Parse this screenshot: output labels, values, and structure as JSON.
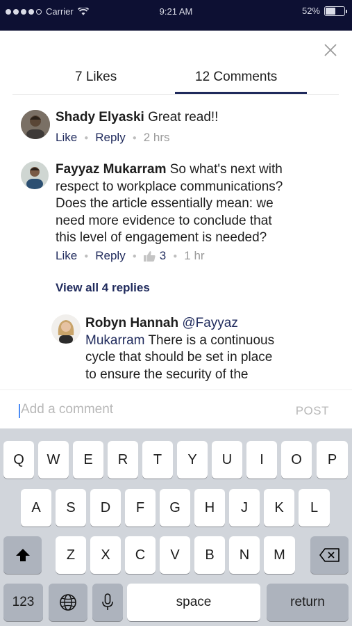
{
  "status_bar": {
    "carrier": "Carrier",
    "time": "9:21 AM",
    "battery": "52%",
    "battery_level": 0.52
  },
  "tabs": {
    "likes": "7 Likes",
    "comments": "12 Comments",
    "active": "comments"
  },
  "comments": [
    {
      "author": "Shady Elyaski",
      "text": " Great read!!",
      "like": "Like",
      "reply": "Reply",
      "time": "2 hrs"
    },
    {
      "author": "Fayyaz Mukarram",
      "text_lines": [
        " So what's next with",
        "respect to workplace communications?",
        "Does the article essentially mean: we",
        "need more evidence to conclude that",
        "this level of engagement is needed?"
      ],
      "like": "Like",
      "reply": "Reply",
      "like_count": "3",
      "time": "1 hr"
    }
  ],
  "view_replies": "View all 4 replies",
  "reply": {
    "author": "Robyn Hannah",
    "mention_line1": "@Fayyaz",
    "mention_line2": "Mukarram",
    "text_line2": " There is a continuous",
    "text_line3": "cycle that should be set in place",
    "text_line4": "to ensure the security of the"
  },
  "composer": {
    "placeholder": "Add a comment",
    "post": "POST"
  },
  "keyboard": {
    "row1": [
      "Q",
      "W",
      "E",
      "R",
      "T",
      "Y",
      "U",
      "I",
      "O",
      "P"
    ],
    "row2": [
      "A",
      "S",
      "D",
      "F",
      "G",
      "H",
      "J",
      "K",
      "L"
    ],
    "row3": [
      "Z",
      "X",
      "C",
      "V",
      "B",
      "N",
      "M"
    ],
    "num_key": "123",
    "space": "space",
    "return": "return"
  },
  "colors": {
    "accent": "#1f2a5c",
    "status_bar": "#0d1033",
    "keyboard_bg": "#d1d5db"
  }
}
